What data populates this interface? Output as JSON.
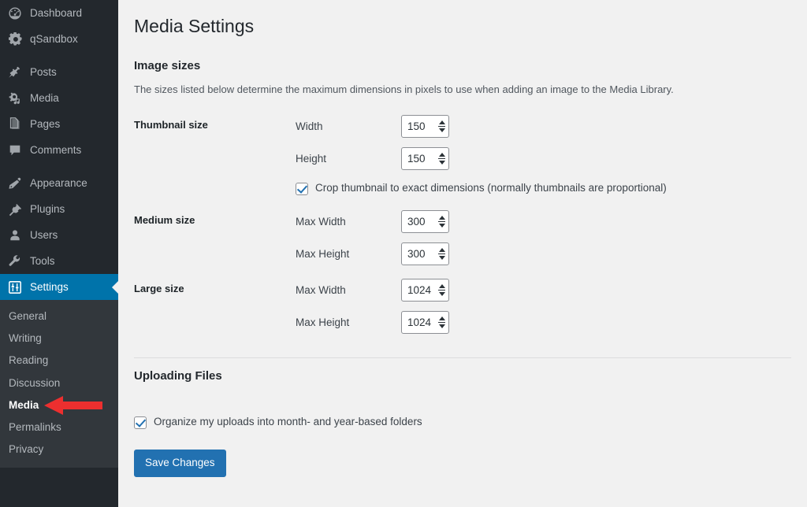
{
  "sidebar": {
    "items": [
      {
        "label": "Dashboard",
        "icon": "dashboard-gauge-icon",
        "name": "dashboard"
      },
      {
        "label": "qSandbox",
        "icon": "gear-icon",
        "name": "qsandbox"
      },
      {
        "separator": true
      },
      {
        "label": "Posts",
        "icon": "pushpin-icon",
        "name": "posts"
      },
      {
        "label": "Media",
        "icon": "media-camera-icon",
        "name": "media"
      },
      {
        "label": "Pages",
        "icon": "pages-stack-icon",
        "name": "pages"
      },
      {
        "label": "Comments",
        "icon": "speech-bubble-icon",
        "name": "comments"
      },
      {
        "separator": true
      },
      {
        "label": "Appearance",
        "icon": "paintbrush-icon",
        "name": "appearance"
      },
      {
        "label": "Plugins",
        "icon": "plug-icon",
        "name": "plugins"
      },
      {
        "label": "Users",
        "icon": "user-icon",
        "name": "users"
      },
      {
        "label": "Tools",
        "icon": "wrench-icon",
        "name": "tools"
      },
      {
        "label": "Settings",
        "icon": "sliders-icon",
        "name": "settings",
        "current": true
      }
    ],
    "submenu": [
      {
        "label": "General",
        "name": "general"
      },
      {
        "label": "Writing",
        "name": "writing"
      },
      {
        "label": "Reading",
        "name": "reading"
      },
      {
        "label": "Discussion",
        "name": "discussion"
      },
      {
        "label": "Media",
        "name": "media",
        "current": true
      },
      {
        "label": "Permalinks",
        "name": "permalinks"
      },
      {
        "label": "Privacy",
        "name": "privacy"
      }
    ],
    "colors": {
      "background": "#23282d",
      "submenu_background": "#32373c",
      "current_highlight": "#0073aa",
      "text": "#b4b9be"
    }
  },
  "annotation": {
    "type": "arrow",
    "direction": "left",
    "color": "#ed2f2f",
    "points_at": "Media"
  },
  "page": {
    "title": "Media Settings",
    "image_sizes": {
      "heading": "Image sizes",
      "description": "The sizes listed below determine the maximum dimensions in pixels to use when adding an image to the Media Library.",
      "rows": [
        {
          "label": "Thumbnail size",
          "fields": [
            {
              "label": "Width",
              "value": "150",
              "name": "thumbnail-width"
            },
            {
              "label": "Height",
              "value": "150",
              "name": "thumbnail-height"
            }
          ],
          "checkbox": {
            "label": "Crop thumbnail to exact dimensions (normally thumbnails are proportional)",
            "checked": true,
            "name": "crop-thumbnail"
          }
        },
        {
          "label": "Medium size",
          "fields": [
            {
              "label": "Max Width",
              "value": "300",
              "name": "medium-max-width"
            },
            {
              "label": "Max Height",
              "value": "300",
              "name": "medium-max-height"
            }
          ]
        },
        {
          "label": "Large size",
          "fields": [
            {
              "label": "Max Width",
              "value": "1024",
              "name": "large-max-width"
            },
            {
              "label": "Max Height",
              "value": "1024",
              "name": "large-max-height"
            }
          ]
        }
      ]
    },
    "uploading_files": {
      "heading": "Uploading Files",
      "checkbox": {
        "label": "Organize my uploads into month- and year-based folders",
        "checked": true,
        "name": "organize-uploads"
      }
    },
    "submit": {
      "label": "Save Changes",
      "color": "#2271b1"
    }
  }
}
